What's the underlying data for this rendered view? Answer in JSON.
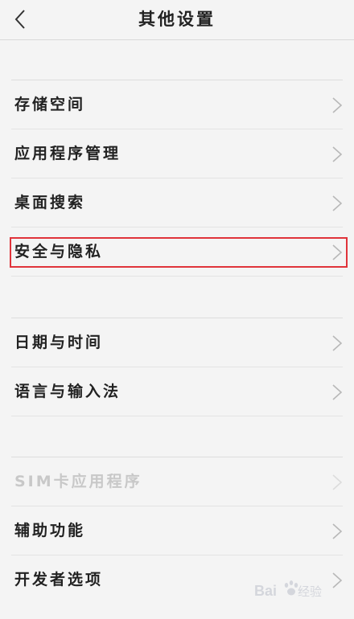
{
  "header": {
    "title": "其他设置",
    "back_icon": "chevron-left-icon"
  },
  "groups": [
    {
      "items": [
        {
          "label": "存储空间",
          "enabled": true
        },
        {
          "label": "应用程序管理",
          "enabled": true
        },
        {
          "label": "桌面搜索",
          "enabled": true
        },
        {
          "label": "安全与隐私",
          "enabled": true,
          "highlighted": true
        }
      ]
    },
    {
      "items": [
        {
          "label": "日期与时间",
          "enabled": true
        },
        {
          "label": "语言与输入法",
          "enabled": true
        }
      ]
    },
    {
      "items": [
        {
          "label": "SIM卡应用程序",
          "enabled": false
        },
        {
          "label": "辅助功能",
          "enabled": true
        },
        {
          "label": "开发者选项",
          "enabled": true
        }
      ]
    }
  ],
  "colors": {
    "background": "#f4f4f4",
    "text": "#222222",
    "disabled_text": "#c8c8c8",
    "chevron": "#b8b8b8",
    "highlight_border": "#e0333a"
  },
  "watermark": {
    "logo_text": "Bai du 经验"
  }
}
